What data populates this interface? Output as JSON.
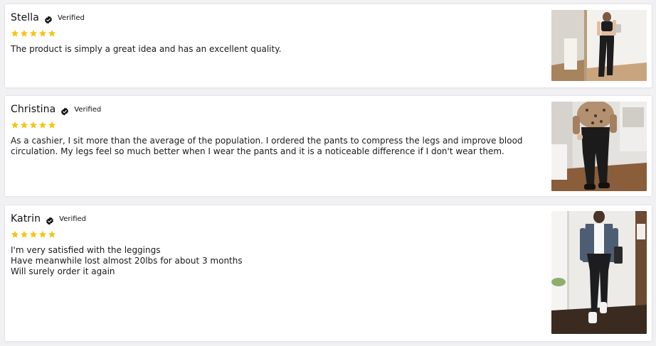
{
  "reviews": [
    {
      "name": "Stella",
      "verified_label": "Verified",
      "rating": 5,
      "lines": [
        "The product is simply a great idea and has an excellent quality."
      ],
      "photo": "woman-black-athletic-set-mirror-photo"
    },
    {
      "name": "Christina",
      "verified_label": "Verified",
      "rating": 5,
      "lines": [
        "As a cashier, I sit more than the average of the population. I ordered the pants to compress the legs and improve blood circulation. My legs feel so much better when I wear the pants and it is a noticeable difference if I don't wear them."
      ],
      "photo": "woman-leopard-sweater-black-leggings-photo"
    },
    {
      "name": "Katrin",
      "verified_label": "Verified",
      "rating": 5,
      "lines": [
        "I'm very satisfied with the leggings",
        "Have meanwhile lost almost 20lbs for about 3 months",
        "Will surely order it again"
      ],
      "photo": "woman-denim-jacket-black-leggings-photo"
    }
  ],
  "colors": {
    "star": "#f5c518",
    "background": "#f1f1f3",
    "card": "#ffffff"
  },
  "icons": {
    "verified": "verified-check-icon",
    "star": "star-icon"
  }
}
